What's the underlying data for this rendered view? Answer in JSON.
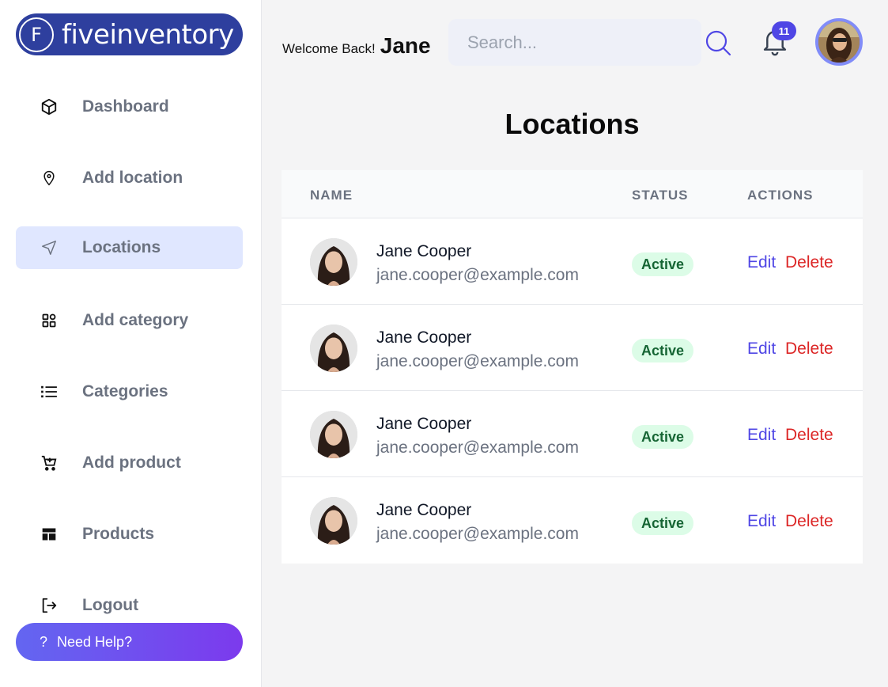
{
  "brand": {
    "logo_letter": "F",
    "name": "fiveinventory"
  },
  "sidebar": {
    "items": [
      {
        "label": "Dashboard",
        "icon": "cube-icon"
      },
      {
        "label": "Add location",
        "icon": "map-pin-icon"
      },
      {
        "label": "Locations",
        "icon": "navigation-arrow-icon",
        "active": true
      },
      {
        "label": "Add category",
        "icon": "category-grid-icon"
      },
      {
        "label": "Categories",
        "icon": "list-icon"
      },
      {
        "label": "Add product",
        "icon": "cart-plus-icon"
      },
      {
        "label": "Products",
        "icon": "layout-icon"
      },
      {
        "label": "Logout",
        "icon": "logout-icon"
      }
    ],
    "help_icon": "?",
    "help_label": "Need Help?"
  },
  "header": {
    "welcome": "Welcome Back!",
    "user_name": "Jane",
    "search_placeholder": "Search...",
    "notification_count": "11"
  },
  "page": {
    "title": "Locations"
  },
  "table": {
    "headers": {
      "name": "NAME",
      "status": "STATUS",
      "actions": "ACTIONS"
    },
    "rows": [
      {
        "name": "Jane Cooper",
        "email": "jane.cooper@example.com",
        "status": "Active",
        "edit": "Edit",
        "delete": "Delete"
      },
      {
        "name": "Jane Cooper",
        "email": "jane.cooper@example.com",
        "status": "Active",
        "edit": "Edit",
        "delete": "Delete"
      },
      {
        "name": "Jane Cooper",
        "email": "jane.cooper@example.com",
        "status": "Active",
        "edit": "Edit",
        "delete": "Delete"
      },
      {
        "name": "Jane Cooper",
        "email": "jane.cooper@example.com",
        "status": "Active",
        "edit": "Edit",
        "delete": "Delete"
      }
    ]
  },
  "colors": {
    "accent": "#4f46e5",
    "active_nav_bg": "#e0e7ff",
    "status_bg": "#dcfce7",
    "status_text": "#166534",
    "delete": "#dc2626"
  }
}
